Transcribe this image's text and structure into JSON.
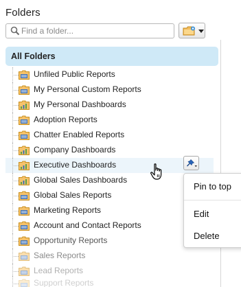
{
  "title": "Folders",
  "search": {
    "placeholder": "Find a folder..."
  },
  "all_folders_label": "All Folders",
  "folders": [
    {
      "label": "Unfiled Public Reports",
      "type": "report"
    },
    {
      "label": "My Personal Custom Reports",
      "type": "report"
    },
    {
      "label": "My Personal Dashboards",
      "type": "dashboard"
    },
    {
      "label": "Adoption Reports",
      "type": "report"
    },
    {
      "label": "Chatter Enabled Reports",
      "type": "report"
    },
    {
      "label": "Company Dashboards",
      "type": "dashboard"
    },
    {
      "label": "Executive Dashboards",
      "type": "dashboard",
      "hovered": true
    },
    {
      "label": "Global Sales Dashboards",
      "type": "dashboard"
    },
    {
      "label": "Global Sales Reports",
      "type": "report"
    },
    {
      "label": "Marketing Reports",
      "type": "report"
    },
    {
      "label": "Account and Contact Reports",
      "type": "report"
    },
    {
      "label": "Opportunity Reports",
      "type": "report"
    },
    {
      "label": "Sales Reports",
      "type": "report"
    },
    {
      "label": "Lead Reports",
      "type": "report"
    },
    {
      "label": "Support Reports",
      "type": "report"
    }
  ],
  "context_menu": {
    "items": [
      "Pin to top",
      "Edit",
      "Delete"
    ]
  },
  "colors": {
    "selected_bg": "#cfe9f7",
    "hover_bg": "#ecf5fb",
    "folder_fill": "#f5c26b",
    "report_icon_bg": "#3b6fb6",
    "dashboard_icon_bar": "#5aa04a",
    "pin_icon": "#2a64b8"
  }
}
